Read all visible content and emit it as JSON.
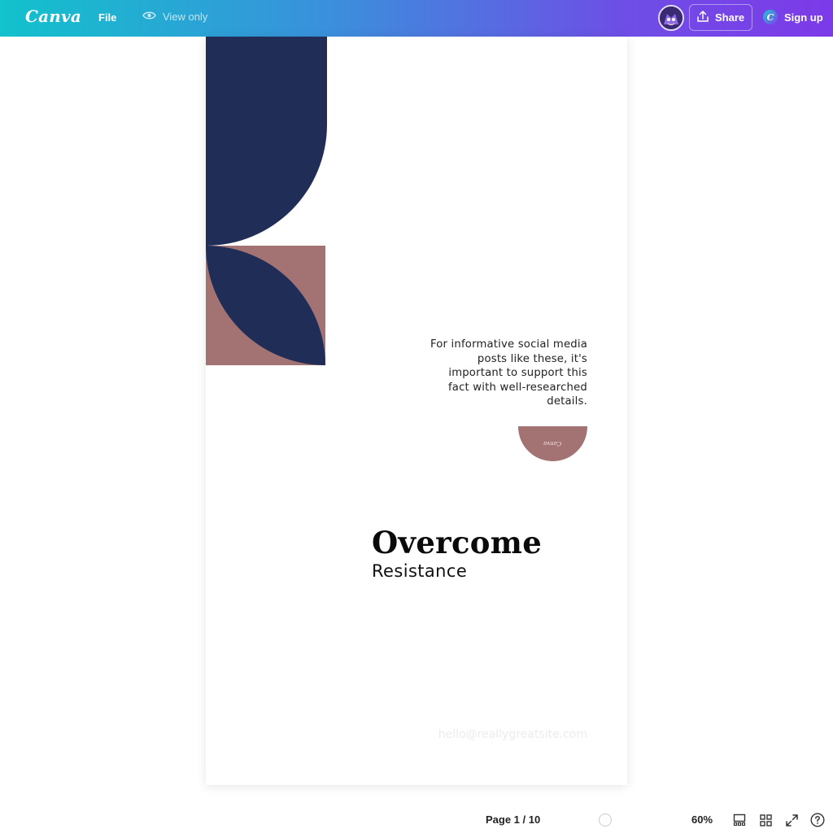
{
  "app": {
    "logo_text": "Canva",
    "file_label": "File",
    "view_only_label": "View only",
    "share_label": "Share",
    "signup_label": "Sign up",
    "signup_badge": "C"
  },
  "colors": {
    "navy": "#1f2d57",
    "rose": "#a37373",
    "gradient_start": "#12c2cc",
    "gradient_end": "#7d3ae8"
  },
  "design": {
    "body_text": "For informative social media posts like these, it's important to support this fact with well-researched details.",
    "seal_text": "Canva",
    "title": "Overcome",
    "subtitle": "Resistance",
    "email": "hello@reallygreatsite.com"
  },
  "footer": {
    "page_indicator": "Page 1 / 10",
    "zoom": "60%"
  },
  "icons": [
    "eye-icon",
    "share-upload-icon",
    "avatar",
    "timer-icon",
    "grid-view-icon",
    "thumbnails-icon",
    "fullscreen-icon",
    "help-icon"
  ]
}
